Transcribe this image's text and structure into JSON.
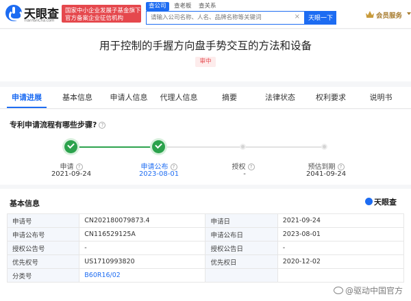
{
  "header": {
    "logo_text": "天眼查",
    "logo_sub": "TianYanCha.com",
    "gov_badge_line1": "国家中小企业发展子基金旗下",
    "gov_badge_line2": "官方备案企业征信机构",
    "search_tabs": [
      "查公司",
      "查老板",
      "查关系"
    ],
    "search_placeholder": "请输入公司名称、人名、品牌名称等关键词",
    "search_clear": "×",
    "search_button": "天眼一下",
    "vip_label": "会员服务"
  },
  "title": {
    "text": "用于控制的手握方向盘手势交互的方法和设备",
    "status": "审中"
  },
  "tabs": [
    "申请进展",
    "基本信息",
    "申请人信息",
    "代理人信息",
    "摘要",
    "法律状态",
    "权利要求",
    "说明书"
  ],
  "progress": {
    "question": "专利申请流程有哪些步骤?",
    "help_glyph": "?",
    "steps": [
      {
        "label": "申请",
        "date": "2021-09-24",
        "done": true
      },
      {
        "label": "申请公布",
        "date": "2023-08-01",
        "done": true
      },
      {
        "label": "授权",
        "date": "-",
        "done": false
      },
      {
        "label": "预估到期",
        "date": "2041-09-24",
        "done": false
      }
    ]
  },
  "basic_info": {
    "title": "基本信息",
    "brand": "天眼查",
    "rows": [
      {
        "k1": "申请号",
        "v1": "CN202180079873.4",
        "k2": "申请日",
        "v2": "2021-09-24"
      },
      {
        "k1": "申请公布号",
        "v1": "CN116529125A",
        "k2": "申请公布日",
        "v2": "2023-08-01"
      },
      {
        "k1": "授权公告号",
        "v1": "-",
        "k2": "授权公告日",
        "v2": "-"
      },
      {
        "k1": "优先权号",
        "v1": "US1710993820",
        "k2": "优先权日",
        "v2": "2020-12-02"
      },
      {
        "k1": "分类号",
        "v1": "B60R16/02",
        "k2": "",
        "v2": ""
      }
    ]
  },
  "watermark": "@驱动中国官方",
  "colors": {
    "accent": "#1d6cf2",
    "done": "#2ba24c",
    "alert": "#e5484d",
    "vip": "#a77b2d"
  }
}
